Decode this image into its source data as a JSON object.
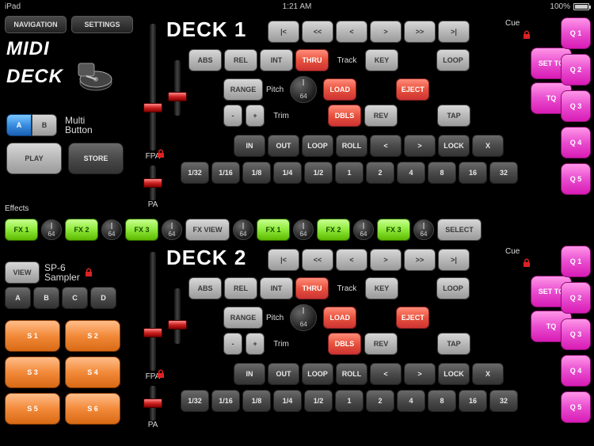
{
  "statusbar": {
    "device": "iPad",
    "time": "1:21 AM",
    "battery": "100%"
  },
  "nav": {
    "navigation": "NAVIGATION",
    "settings": "SETTINGS"
  },
  "logo": {
    "line1": "MIDI",
    "line2": "DECK"
  },
  "multiBtn": {
    "a": "A",
    "b": "B",
    "label1": "Multi",
    "label2": "Button",
    "play": "PLAY",
    "store": "STORE"
  },
  "effectsLabel": "Effects",
  "fx": {
    "fx1": "FX 1",
    "fx2": "FX 2",
    "fx3": "FX 3",
    "fxview": "FX VIEW",
    "select": "SELECT",
    "knob": "64"
  },
  "sampler": {
    "view": "VIEW",
    "title1": "SP-6",
    "title2": "Sampler",
    "t": {
      "a": "A",
      "b": "B",
      "c": "C",
      "d": "D"
    },
    "s": {
      "s1": "S 1",
      "s2": "S 2",
      "s3": "S 3",
      "s4": "S 4",
      "s5": "S 5",
      "s6": "S 6"
    }
  },
  "deck1": {
    "title": "DECK 1",
    "cue": "Cue",
    "transport": {
      "first": "|<",
      "rew": "<<",
      "back": "<",
      "play": ">",
      "fwd": ">>",
      "last": ">|"
    },
    "row1": {
      "abs": "ABS",
      "rel": "REL",
      "int": "INT",
      "thru": "THRU",
      "track": "Track",
      "key": "KEY",
      "loop": "LOOP"
    },
    "row2": {
      "range": "RANGE",
      "pitch": "Pitch",
      "trim": "64",
      "load": "LOAD",
      "eject": "EJECT"
    },
    "row3": {
      "minus": "-",
      "plus": "+",
      "trimLabel": "Trim",
      "dbls": "DBLS",
      "rev": "REV",
      "tap": "TAP"
    },
    "loop": {
      "in": "IN",
      "out": "OUT",
      "loop": "LOOP",
      "roll": "ROLL",
      "lt": "<",
      "gt": ">",
      "lock": "LOCK",
      "x": "X"
    },
    "beats": {
      "b1": "1/32",
      "b2": "1/16",
      "b3": "1/8",
      "b4": "1/4",
      "b5": "1/2",
      "b6": "1",
      "b7": "2",
      "b8": "4",
      "b9": "8",
      "b10": "16",
      "b11": "32"
    },
    "cues": {
      "settq": "SET TQ",
      "tq": "TQ",
      "q1": "Q 1",
      "q2": "Q 2",
      "q3": "Q 3",
      "q4": "Q 4",
      "q5": "Q 5"
    },
    "sliderLabels": {
      "fpa": "FPA",
      "pa": "PA"
    }
  },
  "deck2": {
    "title": "DECK 2",
    "cue": "Cue",
    "transport": {
      "first": "|<",
      "rew": "<<",
      "back": "<",
      "play": ">",
      "fwd": ">>",
      "last": ">|"
    },
    "row1": {
      "abs": "ABS",
      "rel": "REL",
      "int": "INT",
      "thru": "THRU",
      "track": "Track",
      "key": "KEY",
      "loop": "LOOP"
    },
    "row2": {
      "range": "RANGE",
      "pitch": "Pitch",
      "trim": "64",
      "load": "LOAD",
      "eject": "EJECT"
    },
    "row3": {
      "minus": "-",
      "plus": "+",
      "trimLabel": "Trim",
      "dbls": "DBLS",
      "rev": "REV",
      "tap": "TAP"
    },
    "loop": {
      "in": "IN",
      "out": "OUT",
      "loop": "LOOP",
      "roll": "ROLL",
      "lt": "<",
      "gt": ">",
      "lock": "LOCK",
      "x": "X"
    },
    "beats": {
      "b1": "1/32",
      "b2": "1/16",
      "b3": "1/8",
      "b4": "1/4",
      "b5": "1/2",
      "b6": "1",
      "b7": "2",
      "b8": "4",
      "b9": "8",
      "b10": "16",
      "b11": "32"
    },
    "cues": {
      "settq": "SET TQ",
      "tq": "TQ",
      "q1": "Q 1",
      "q2": "Q 2",
      "q3": "Q 3",
      "q4": "Q 4",
      "q5": "Q 5"
    },
    "sliderLabels": {
      "fpa": "FPA",
      "pa": "PA"
    }
  }
}
